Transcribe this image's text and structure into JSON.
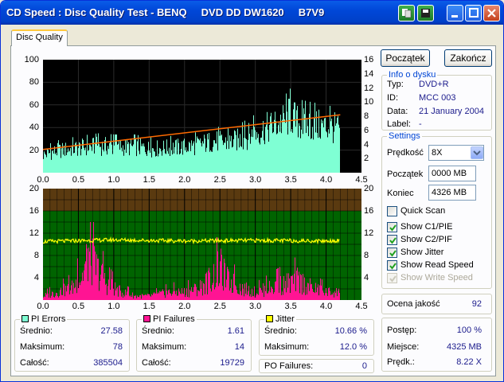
{
  "window": {
    "title": "CD Speed : Disc Quality Test - BENQ     DVD DD DW1620     B7V9"
  },
  "tabs": [
    {
      "label": "Disc Quality"
    }
  ],
  "buttons": {
    "start": "Początek",
    "end": "Zakończ"
  },
  "disc_info": {
    "title": "Info o dysku",
    "type_label": "Typ:",
    "type_value": "DVD+R",
    "id_label": "ID:",
    "id_value": "MCC 003",
    "date_label": "Data:",
    "date_value": "21 January 2004",
    "label_label": "Label:",
    "label_value": "-"
  },
  "settings": {
    "title": "Settings",
    "speed_label": "Prędkość",
    "speed_value": "8X",
    "start_label": "Początek",
    "start_value": "0000 MB",
    "end_label": "Koniec",
    "end_value": "4326 MB",
    "quick_scan": "Quick Scan",
    "show_c1": "Show C1/PIE",
    "show_c2": "Show C2/PIF",
    "show_jitter": "Show Jitter",
    "show_read": "Show Read Speed",
    "show_write": "Show Write Speed"
  },
  "quality": {
    "label": "Ocena jakość",
    "value": "92"
  },
  "progress": {
    "progress_label": "Postęp:",
    "progress_value": "100 %",
    "position_label": "Miejsce:",
    "position_value": "4325 MB",
    "speed_label": "Prędk.:",
    "speed_value": "8.22 X"
  },
  "pi_errors": {
    "title": "PI Errors",
    "avg_label": "Średnio:",
    "avg": "27.58",
    "max_label": "Maksimum:",
    "max": "78",
    "total_label": "Całość:",
    "total": "385504"
  },
  "pi_failures": {
    "title": "PI Failures",
    "avg_label": "Średnio:",
    "avg": "1.61",
    "max_label": "Maksimum:",
    "max": "14",
    "total_label": "Całość:",
    "total": "19729"
  },
  "jitter": {
    "title": "Jitter",
    "avg_label": "Średnio:",
    "avg": "10.66 %",
    "max_label": "Maksimum:",
    "max": "12.0 %",
    "po_label": "PO Failures:",
    "po": "0"
  },
  "colors": {
    "pie": "#7fffd4",
    "pif": "#ff1493",
    "jitter": "#ffff00",
    "read": "#ff6a00",
    "plot_bg": "#000000",
    "band_green": "#006400",
    "band_brown": "#5a3a10"
  },
  "chart_data": [
    {
      "type": "area",
      "name": "PI Errors",
      "xlim": [
        0,
        4.5
      ],
      "ylim": [
        0,
        100
      ],
      "ylim_right": [
        0,
        16
      ],
      "x_ticks": [
        "0.0",
        "0.5",
        "1.0",
        "1.5",
        "2.0",
        "2.5",
        "3.0",
        "3.5",
        "4.0",
        "4.5"
      ],
      "y_ticks_left": [
        "100",
        "80",
        "60",
        "40",
        "20"
      ],
      "y_ticks_right": [
        "16",
        "14",
        "12",
        "10",
        "8",
        "6",
        "4",
        "2"
      ],
      "series": [
        {
          "values_x": [
            0.0,
            0.2,
            0.5,
            0.8,
            1.0,
            1.3,
            1.5,
            1.8,
            2.0,
            2.2,
            2.4,
            2.6,
            2.8,
            3.0,
            3.2,
            3.4,
            3.5,
            3.6,
            3.8,
            4.0,
            4.2
          ],
          "values_y": [
            18,
            22,
            25,
            27,
            26,
            26,
            24,
            25,
            26,
            28,
            32,
            30,
            34,
            40,
            46,
            52,
            58,
            50,
            48,
            46,
            44
          ]
        },
        {
          "values_x": [
            0.0,
            4.2
          ],
          "values_y": [
            3.3,
            8.2
          ]
        }
      ]
    },
    {
      "type": "area",
      "name": "PI Failures",
      "xlim": [
        0,
        4.5
      ],
      "ylim": [
        0,
        20
      ],
      "ylim_right": [
        0,
        20
      ],
      "x_ticks": [
        "0.0",
        "0.5",
        "1.0",
        "1.5",
        "2.0",
        "2.5",
        "3.0",
        "3.5",
        "4.0",
        "4.5"
      ],
      "y_ticks_left": [
        "20",
        "16",
        "12",
        "8",
        "4"
      ],
      "y_ticks_right": [
        "20",
        "16",
        "12",
        "8",
        "4"
      ],
      "series": [
        {
          "values_x": [
            0.0,
            0.2,
            0.4,
            0.55,
            0.65,
            0.75,
            0.9,
            1.1,
            1.3,
            1.5,
            1.8,
            2.0,
            2.2,
            2.4,
            2.5,
            2.6,
            2.8,
            3.0,
            3.2,
            3.4,
            3.6,
            3.8,
            4.0,
            4.2
          ],
          "values_y": [
            1,
            2,
            3,
            6,
            12,
            8,
            4,
            2,
            1,
            1,
            2,
            2,
            3,
            6,
            8,
            5,
            3,
            2,
            3,
            4,
            5,
            3,
            2,
            2
          ]
        },
        {
          "values_x": [
            0.0,
            1.0,
            2.0,
            3.0,
            4.0,
            4.2
          ],
          "values_y": [
            10.5,
            10.8,
            10.6,
            10.7,
            10.6,
            10.7
          ]
        }
      ]
    }
  ]
}
